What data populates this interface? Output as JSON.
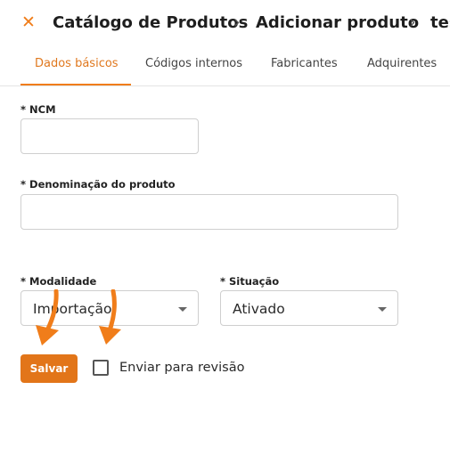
{
  "header": {
    "close_icon": "close-icon",
    "breadcrumb": [
      "Catálogo de Produtos",
      "Adicionar produto",
      "tes"
    ],
    "separator": "›"
  },
  "tabs": [
    {
      "label": "Dados básicos",
      "active": true
    },
    {
      "label": "Códigos internos",
      "active": false
    },
    {
      "label": "Fabricantes",
      "active": false
    },
    {
      "label": "Adquirentes",
      "active": false
    }
  ],
  "form": {
    "ncm": {
      "label": "* NCM",
      "value": ""
    },
    "denominacao": {
      "label": "* Denominação do produto",
      "value": ""
    },
    "modalidade": {
      "label": "* Modalidade",
      "value": "Importação"
    },
    "situacao": {
      "label": "* Situação",
      "value": "Ativado"
    }
  },
  "actions": {
    "save_label": "Salvar",
    "review_label": "Enviar para revisão",
    "review_checked": false
  },
  "colors": {
    "accent": "#f07d1a",
    "button": "#e27519",
    "annotation_arrow": "#f07d1a"
  },
  "annotations": [
    "arrow-icon",
    "arrow-icon"
  ]
}
